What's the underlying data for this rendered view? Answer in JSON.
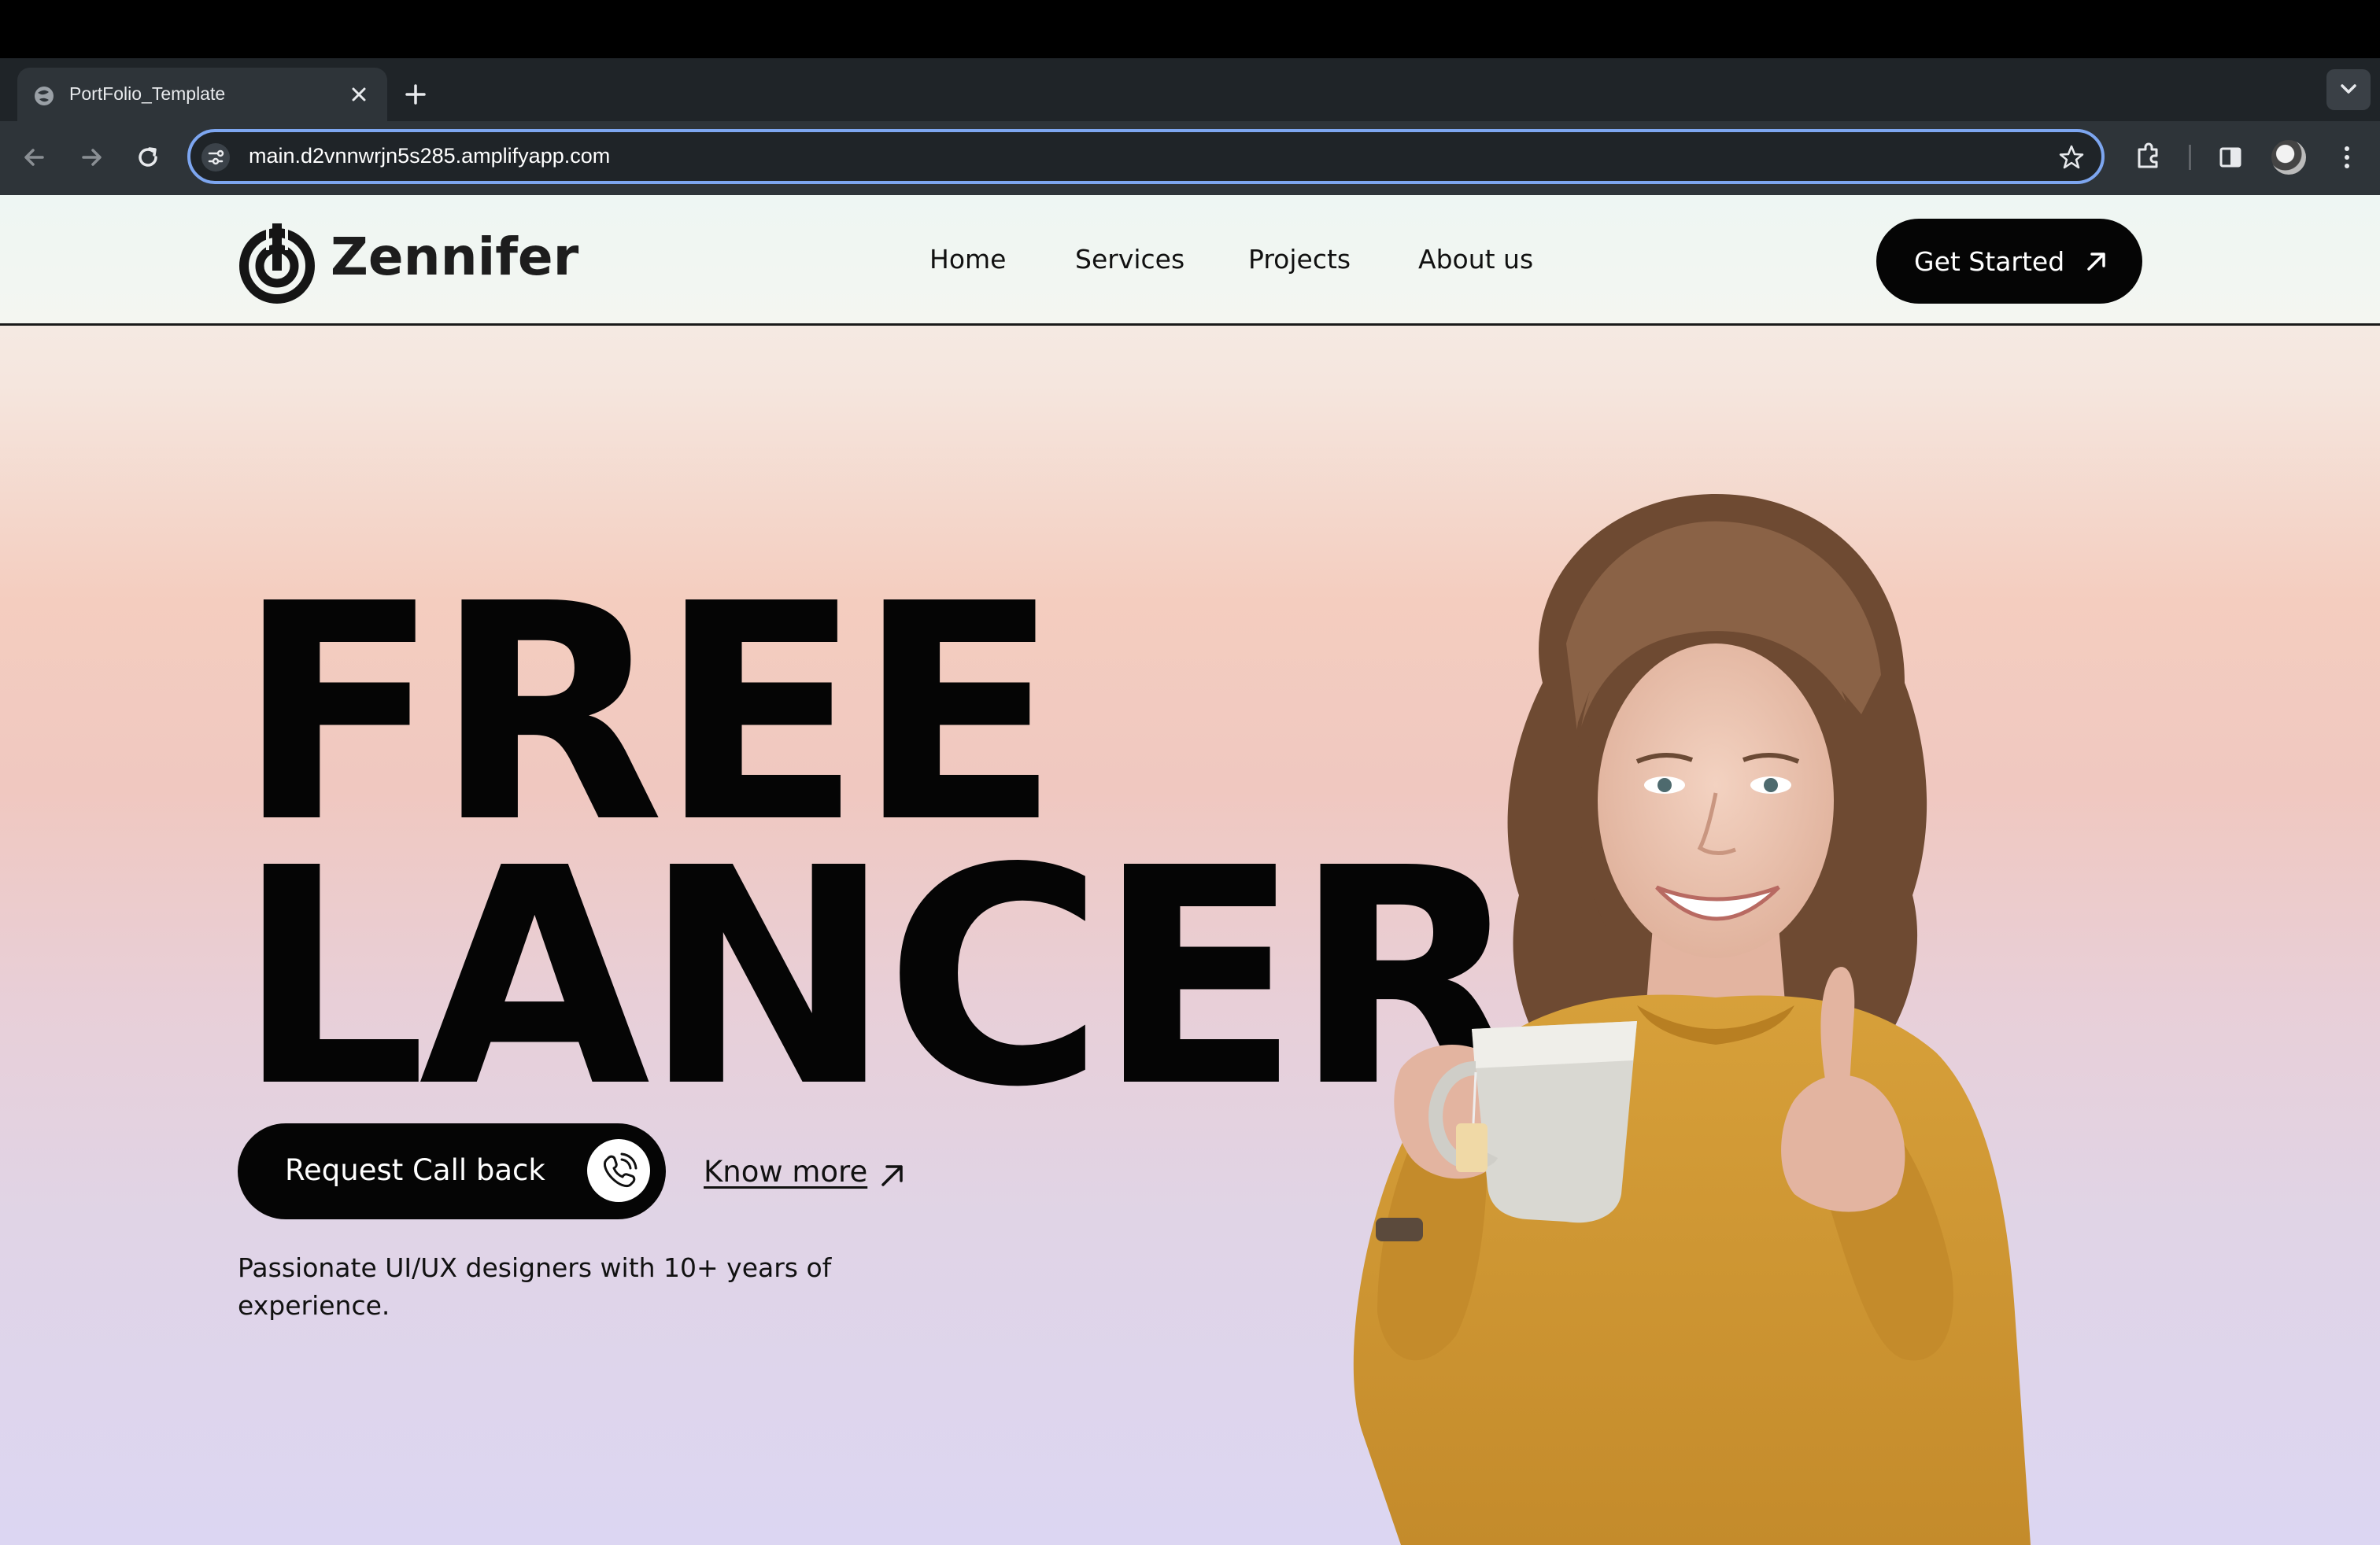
{
  "browser": {
    "tab_title": "PortFolio_Template",
    "url": "main.d2vnnwrjn5s285.amplifyapp.com"
  },
  "site": {
    "brand": "Zennifer",
    "nav": [
      "Home",
      "Services",
      "Projects",
      "About us"
    ],
    "cta_label": "Get Started"
  },
  "hero": {
    "line1": "FREE",
    "line2": "LANCER",
    "callback_label": "Request Call back",
    "know_more_label": "Know more",
    "tagline": "Passionate UI/UX designers with 10+ years of experience."
  },
  "colors": {
    "accent": "#050505",
    "focus_ring": "#7da6f0",
    "sweater": "#d9a236"
  },
  "icons": {
    "back": "arrow-left-icon",
    "forward": "arrow-right-icon",
    "reload": "reload-icon",
    "site_settings": "tune-icon",
    "bookmark": "star-icon",
    "extensions": "puzzle-icon",
    "side_panel": "side-panel-icon",
    "menu": "kebab-icon",
    "phone": "phone-icon",
    "arrow": "arrow-up-right-icon"
  }
}
